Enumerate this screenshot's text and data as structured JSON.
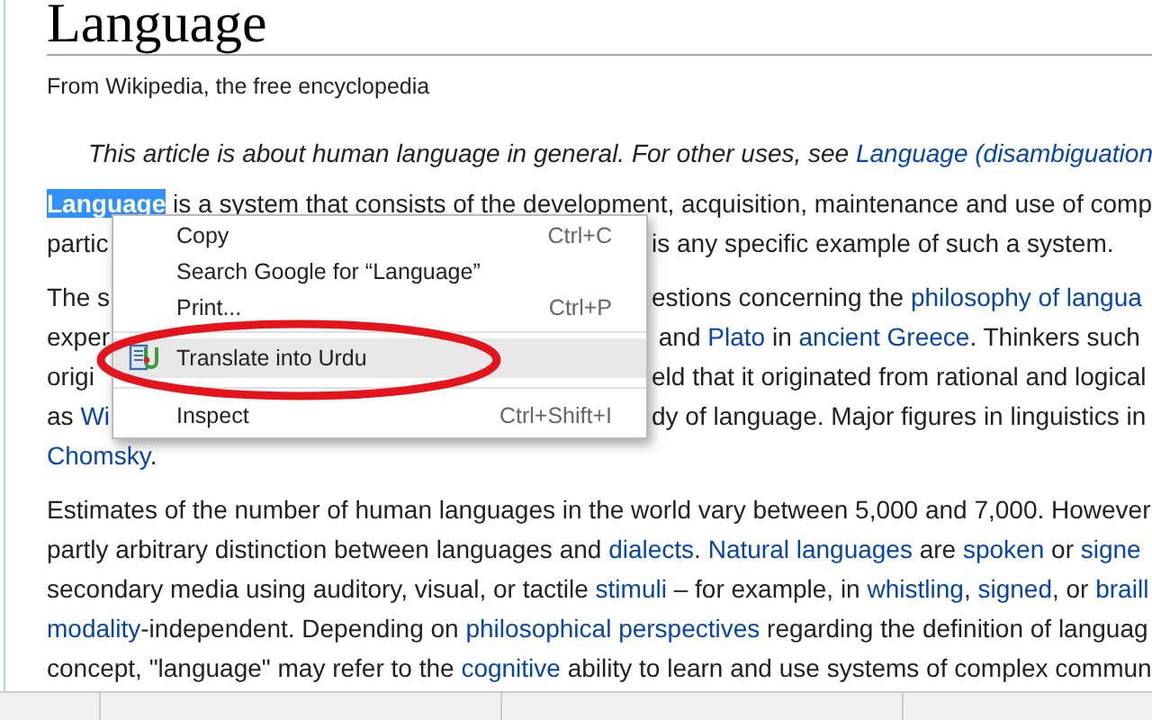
{
  "article": {
    "title": "Language",
    "tagline": "From Wikipedia, the free encyclopedia",
    "hatnote": [
      {
        "kind": "text",
        "text": "This article is about human language in general. For other uses, see "
      },
      {
        "kind": "link",
        "text": "Language (disambiguation"
      }
    ],
    "paragraphs": [
      {
        "lines": [
          {
            "left": [
              {
                "kind": "selected",
                "text": "Language"
              },
              {
                "kind": "text",
                "text": " is a system that consists of the development, acquisition, maintenance and use of comp"
              }
            ]
          },
          {
            "left": [
              {
                "kind": "text",
                "text": "partic"
              }
            ],
            "right": [
              {
                "kind": "text",
                "text": "is any specific example of such a system."
              }
            ]
          }
        ]
      },
      {
        "lines": [
          {
            "left": [
              {
                "kind": "text",
                "text": "The s"
              }
            ],
            "right": [
              {
                "kind": "text",
                "text": "estions concerning the "
              },
              {
                "kind": "link",
                "text": "philosophy of langua"
              }
            ]
          },
          {
            "left": [
              {
                "kind": "text",
                "text": "exper"
              }
            ],
            "right": [
              {
                "kind": "text",
                "text": " and "
              },
              {
                "kind": "link",
                "text": "Plato"
              },
              {
                "kind": "text",
                "text": " in "
              },
              {
                "kind": "link",
                "text": "ancient Greece"
              },
              {
                "kind": "text",
                "text": ". Thinkers such"
              }
            ]
          },
          {
            "left": [
              {
                "kind": "text",
                "text": "origi"
              }
            ],
            "right": [
              {
                "kind": "text",
                "text": "eld that it originated from rational and logical"
              }
            ]
          },
          {
            "left": [
              {
                "kind": "text",
                "text": "as "
              },
              {
                "kind": "link",
                "text": "Wi"
              }
            ],
            "right": [
              {
                "kind": "text",
                "text": "dy of language. Major figures in linguistics in"
              }
            ]
          },
          {
            "left": [
              {
                "kind": "link",
                "text": "Chomsky"
              },
              {
                "kind": "text",
                "text": "."
              }
            ]
          }
        ]
      },
      {
        "lines": [
          {
            "left": [
              {
                "kind": "text",
                "text": "Estimates of the number of human languages in the world vary between 5,000 and 7,000. However"
              }
            ]
          },
          {
            "left": [
              {
                "kind": "text",
                "text": "partly arbitrary distinction between languages and "
              },
              {
                "kind": "link",
                "text": "dialects"
              },
              {
                "kind": "text",
                "text": ". "
              },
              {
                "kind": "link",
                "text": "Natural languages"
              },
              {
                "kind": "text",
                "text": " are "
              },
              {
                "kind": "link",
                "text": "spoken"
              },
              {
                "kind": "text",
                "text": " or "
              },
              {
                "kind": "link",
                "text": "signe"
              }
            ]
          },
          {
            "left": [
              {
                "kind": "text",
                "text": "secondary media using auditory, visual, or tactile "
              },
              {
                "kind": "link",
                "text": "stimuli"
              },
              {
                "kind": "text",
                "text": " – for example, in "
              },
              {
                "kind": "link",
                "text": "whistling"
              },
              {
                "kind": "text",
                "text": ", "
              },
              {
                "kind": "link",
                "text": "signed"
              },
              {
                "kind": "text",
                "text": ", or "
              },
              {
                "kind": "link",
                "text": "braill"
              }
            ]
          },
          {
            "left": [
              {
                "kind": "link",
                "text": "modality"
              },
              {
                "kind": "text",
                "text": "-independent. Depending on "
              },
              {
                "kind": "link",
                "text": "philosophical perspectives"
              },
              {
                "kind": "text",
                "text": " regarding the definition of languag"
              }
            ]
          },
          {
            "left": [
              {
                "kind": "text",
                "text": "concept, \"language\" may refer to the "
              },
              {
                "kind": "link",
                "text": "cognitive"
              },
              {
                "kind": "text",
                "text": " ability to learn and use systems of complex commun"
              }
            ]
          }
        ]
      }
    ]
  },
  "context_menu": {
    "items": [
      {
        "kind": "item",
        "label": "Copy",
        "shortcut": "Ctrl+C",
        "highlighted": false
      },
      {
        "kind": "item",
        "label": "Search Google for “Language”",
        "highlighted": false
      },
      {
        "kind": "item",
        "label": "Print...",
        "shortcut": "Ctrl+P",
        "highlighted": false
      },
      {
        "kind": "separator"
      },
      {
        "kind": "extension",
        "label": "Translate into Urdu",
        "highlighted": true
      },
      {
        "kind": "separator"
      },
      {
        "kind": "item",
        "label": "Inspect",
        "shortcut": "Ctrl+Shift+I",
        "highlighted": false
      }
    ]
  }
}
